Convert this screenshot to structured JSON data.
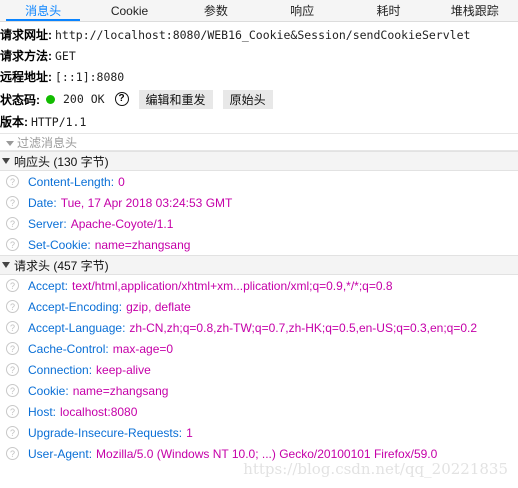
{
  "tabs": [
    "消息头",
    "Cookie",
    "参数",
    "响应",
    "耗时",
    "堆栈跟踪"
  ],
  "summary": {
    "url_label": "请求网址:",
    "url": "http://localhost:8080/WEB16_Cookie&Session/sendCookieServlet",
    "method_label": "请求方法:",
    "method": "GET",
    "remote_label": "远程地址:",
    "remote": "[::1]:8080",
    "status_label": "状态码:",
    "status": "200 OK",
    "edit_resend": "编辑和重发",
    "raw_headers": "原始头",
    "version_label": "版本:",
    "version": "HTTP/1.1"
  },
  "filter_placeholder": "过滤消息头",
  "response_section": "响应头 (130 字节)",
  "response_headers": [
    {
      "name": "Content-Length:",
      "value": "0"
    },
    {
      "name": "Date:",
      "value": "Tue, 17 Apr 2018 03:24:53 GMT"
    },
    {
      "name": "Server:",
      "value": "Apache-Coyote/1.1"
    },
    {
      "name": "Set-Cookie:",
      "value": "name=zhangsang"
    }
  ],
  "request_section": "请求头 (457 字节)",
  "request_headers": [
    {
      "name": "Accept:",
      "value": "text/html,application/xhtml+xm...plication/xml;q=0.9,*/*;q=0.8"
    },
    {
      "name": "Accept-Encoding:",
      "value": "gzip, deflate"
    },
    {
      "name": "Accept-Language:",
      "value": "zh-CN,zh;q=0.8,zh-TW;q=0.7,zh-HK;q=0.5,en-US;q=0.3,en;q=0.2"
    },
    {
      "name": "Cache-Control:",
      "value": "max-age=0"
    },
    {
      "name": "Connection:",
      "value": "keep-alive"
    },
    {
      "name": "Cookie:",
      "value": "name=zhangsang"
    },
    {
      "name": "Host:",
      "value": "localhost:8080"
    },
    {
      "name": "Upgrade-Insecure-Requests:",
      "value": "1"
    },
    {
      "name": "User-Agent:",
      "value": "Mozilla/5.0 (Windows NT 10.0; ...) Gecko/20100101 Firefox/59.0"
    }
  ],
  "watermark": "https://blog.csdn.net/qq_20221835",
  "colors": {
    "accent": "#0a84ff",
    "status_ok": "#12bc00",
    "header_name": "#0a6fd6",
    "header_value": "#c500a8"
  }
}
